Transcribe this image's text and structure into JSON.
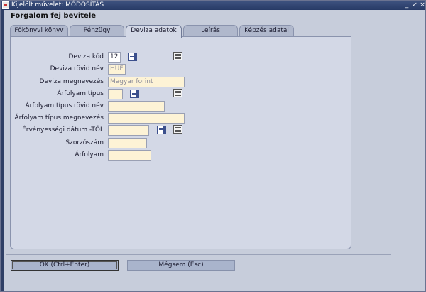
{
  "window": {
    "title": "Kijelölt művelet: MÓDOSÍTÁS",
    "min": "_",
    "max": "↙",
    "close": "×"
  },
  "header": {
    "title": "Forgalom fej bevitele"
  },
  "tabs": [
    {
      "label": "Főkönyvi könyv",
      "active": false
    },
    {
      "label": "Pénzügy",
      "active": false
    },
    {
      "label": "Deviza adatok",
      "active": true
    },
    {
      "label": "Leírás",
      "active": false
    },
    {
      "label": "Képzés adatai",
      "active": false
    }
  ],
  "form": {
    "deviza_kod": {
      "label": "Deviza kód",
      "value": "12"
    },
    "deviza_rovid_nev": {
      "label": "Deviza rövid név",
      "value": "HUF"
    },
    "deviza_megnevezes": {
      "label": "Deviza megnevezés",
      "value": "Magyar forint"
    },
    "arfolyam_tipus": {
      "label": "Árfolyam típus",
      "value": ""
    },
    "arfolyam_tipus_rovid_nev": {
      "label": "Árfolyam típus rövid név",
      "value": ""
    },
    "arfolyam_tipus_megnevezes": {
      "label": "Árfolyam típus megnevezés",
      "value": ""
    },
    "ervenyessegi_datum": {
      "label": "Érvényességi dátum -TÓL",
      "value": ""
    },
    "szorzoszam": {
      "label": "Szorzószám",
      "value": ""
    },
    "arfolyam": {
      "label": "Árfolyam",
      "value": ""
    }
  },
  "buttons": {
    "ok": "OK (Ctrl+Enter)",
    "cancel": "Mégsem (Esc)"
  },
  "colors": {
    "field_bg": "#fdf3d6",
    "panel_bg": "#d3d8e6",
    "window_bg": "#c7cddb",
    "titlebar": "#273a66"
  }
}
